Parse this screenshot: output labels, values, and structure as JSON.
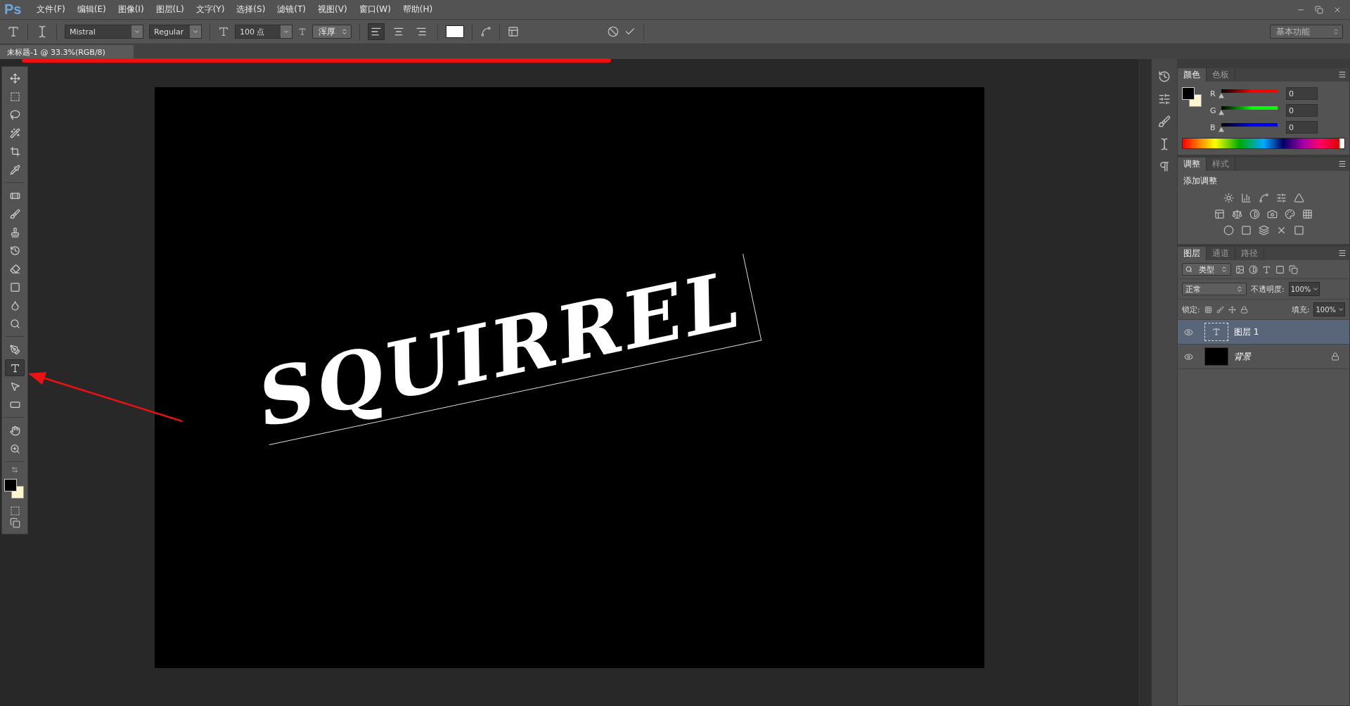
{
  "menu_bar": {
    "logo": "Ps",
    "items": [
      "文件(F)",
      "编辑(E)",
      "图像(I)",
      "图层(L)",
      "文字(Y)",
      "选择(S)",
      "滤镜(T)",
      "视图(V)",
      "窗口(W)",
      "帮助(H)"
    ]
  },
  "options_bar": {
    "font_family": "Mistral",
    "font_style": "Regular",
    "font_size": "100 点",
    "antialias": "浑厚",
    "align": [
      {
        "kind": "left",
        "selected": true
      },
      {
        "kind": "center",
        "selected": false
      },
      {
        "kind": "right",
        "selected": false
      }
    ],
    "workspace": "基本功能"
  },
  "document_tab": {
    "title": "未标题-1 @ 33.3%(RGB/8)"
  },
  "tool_groups": [
    [
      {
        "kind": "move",
        "selected": false
      },
      {
        "kind": "marquee",
        "selected": false
      },
      {
        "kind": "lasso",
        "selected": false
      },
      {
        "kind": "wand",
        "selected": false
      },
      {
        "kind": "crop",
        "selected": false
      },
      {
        "kind": "eyedropper",
        "selected": false
      }
    ],
    [
      {
        "kind": "heal",
        "selected": false
      },
      {
        "kind": "brush",
        "selected": false
      },
      {
        "kind": "stamp",
        "selected": false
      },
      {
        "kind": "history",
        "selected": false
      },
      {
        "kind": "eraser",
        "selected": false
      },
      {
        "kind": "gradient",
        "selected": false
      },
      {
        "kind": "blur",
        "selected": false
      },
      {
        "kind": "dodge",
        "selected": false
      }
    ],
    [
      {
        "kind": "pen",
        "selected": false
      },
      {
        "kind": "type",
        "selected": true
      },
      {
        "kind": "path",
        "selected": false
      },
      {
        "kind": "shape",
        "selected": false
      }
    ],
    [
      {
        "kind": "hand",
        "selected": false
      },
      {
        "kind": "zoom",
        "selected": false
      }
    ]
  ],
  "canvas": {
    "text": "SQUIRREL"
  },
  "color_panel": {
    "tabs": [
      {
        "label": "颜色",
        "selected": true
      },
      {
        "label": "色板",
        "selected": false
      }
    ],
    "channels": [
      {
        "label": "R",
        "value": "0",
        "level": 0,
        "color": "#ff0000"
      },
      {
        "label": "G",
        "value": "0",
        "level": 0,
        "color": "#00ff00"
      },
      {
        "label": "B",
        "value": "0",
        "level": 0,
        "color": "#0000ff"
      }
    ]
  },
  "adjustments_panel": {
    "tabs": [
      {
        "label": "调整",
        "selected": true
      },
      {
        "label": "样式",
        "selected": false
      }
    ],
    "heading": "添加调整"
  },
  "layers_panel": {
    "tabs": [
      {
        "label": "图层",
        "selected": true
      },
      {
        "label": "通道",
        "selected": false
      },
      {
        "label": "路径",
        "selected": false
      }
    ],
    "filter": "类型",
    "blend_mode": "正常",
    "opacity_label": "不透明度:",
    "opacity": "100%",
    "lock_label": "锁定:",
    "fill_label": "填充:",
    "fill": "100%",
    "layers": [
      {
        "name": "图层 1",
        "kind": "text",
        "selected": true,
        "visible": true,
        "locked": false
      },
      {
        "name": "背景",
        "kind": "fill",
        "selected": false,
        "visible": true,
        "locked": true
      }
    ]
  }
}
